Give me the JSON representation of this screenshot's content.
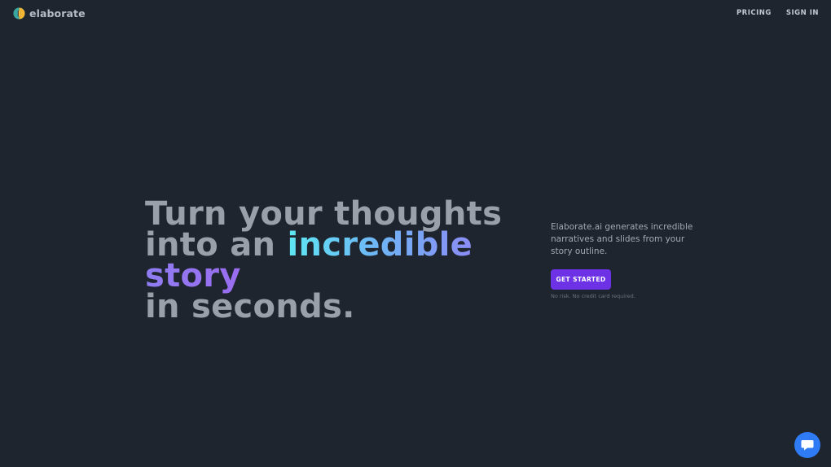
{
  "brand": {
    "name": "elaborate",
    "logo_icon": "elaborate-logo-icon"
  },
  "nav": {
    "pricing": "PRICING",
    "sign_in": "SIGN IN"
  },
  "hero": {
    "line1": "Turn your thoughts",
    "line2_prefix": "into an ",
    "line2_highlight": "incredible",
    "line3_highlight": "story",
    "line4": "in seconds.",
    "description": "Elaborate.ai generates incredible narratives and slides from your story outline.",
    "cta_label": "GET STARTED",
    "fineprint": "No risk. No credit card required."
  },
  "chat": {
    "icon": "chat-bubble-icon"
  },
  "colors": {
    "background": "#1f252e",
    "headline": "#9aa0aa",
    "cta": "#6d32e6",
    "chat": "#2f7bf5",
    "gradient_start": "#5ee7f3",
    "gradient_end": "#9a6cf0"
  }
}
